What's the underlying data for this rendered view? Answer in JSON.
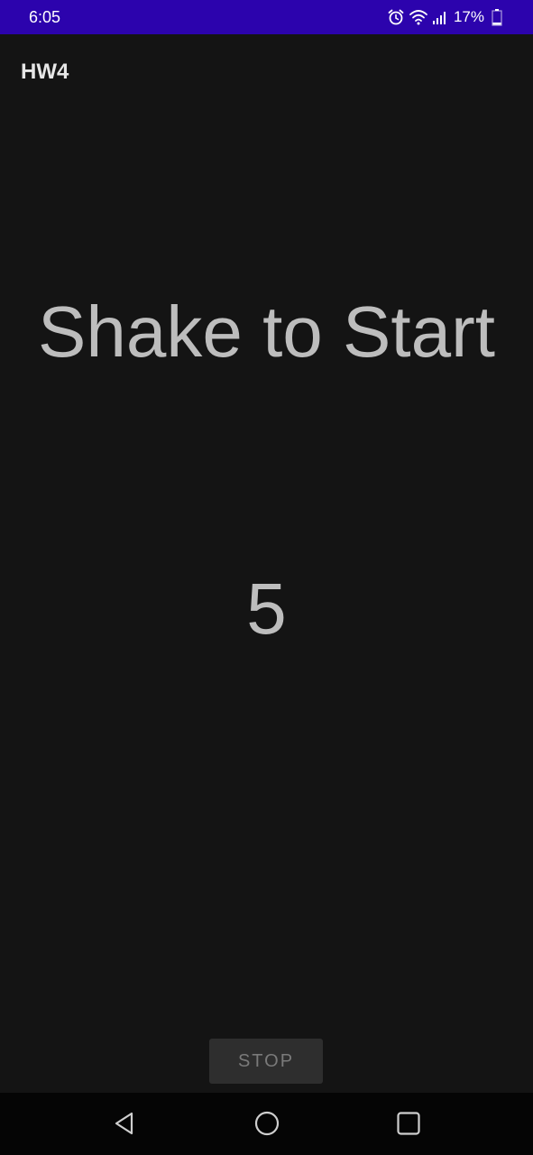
{
  "status_bar": {
    "time": "6:05",
    "battery_percent": "17%",
    "battery_level": 0.17,
    "icons": [
      "alarm-icon",
      "wifi-icon",
      "signal-icon",
      "battery-icon"
    ],
    "background_color": "#2c03ad"
  },
  "app_bar": {
    "title": "HW4"
  },
  "main": {
    "headline": "Shake to Start",
    "counter": "5"
  },
  "controls": {
    "stop_label": "STOP"
  },
  "nav_bar": {
    "buttons": [
      "back-icon",
      "home-icon",
      "recents-icon"
    ]
  }
}
